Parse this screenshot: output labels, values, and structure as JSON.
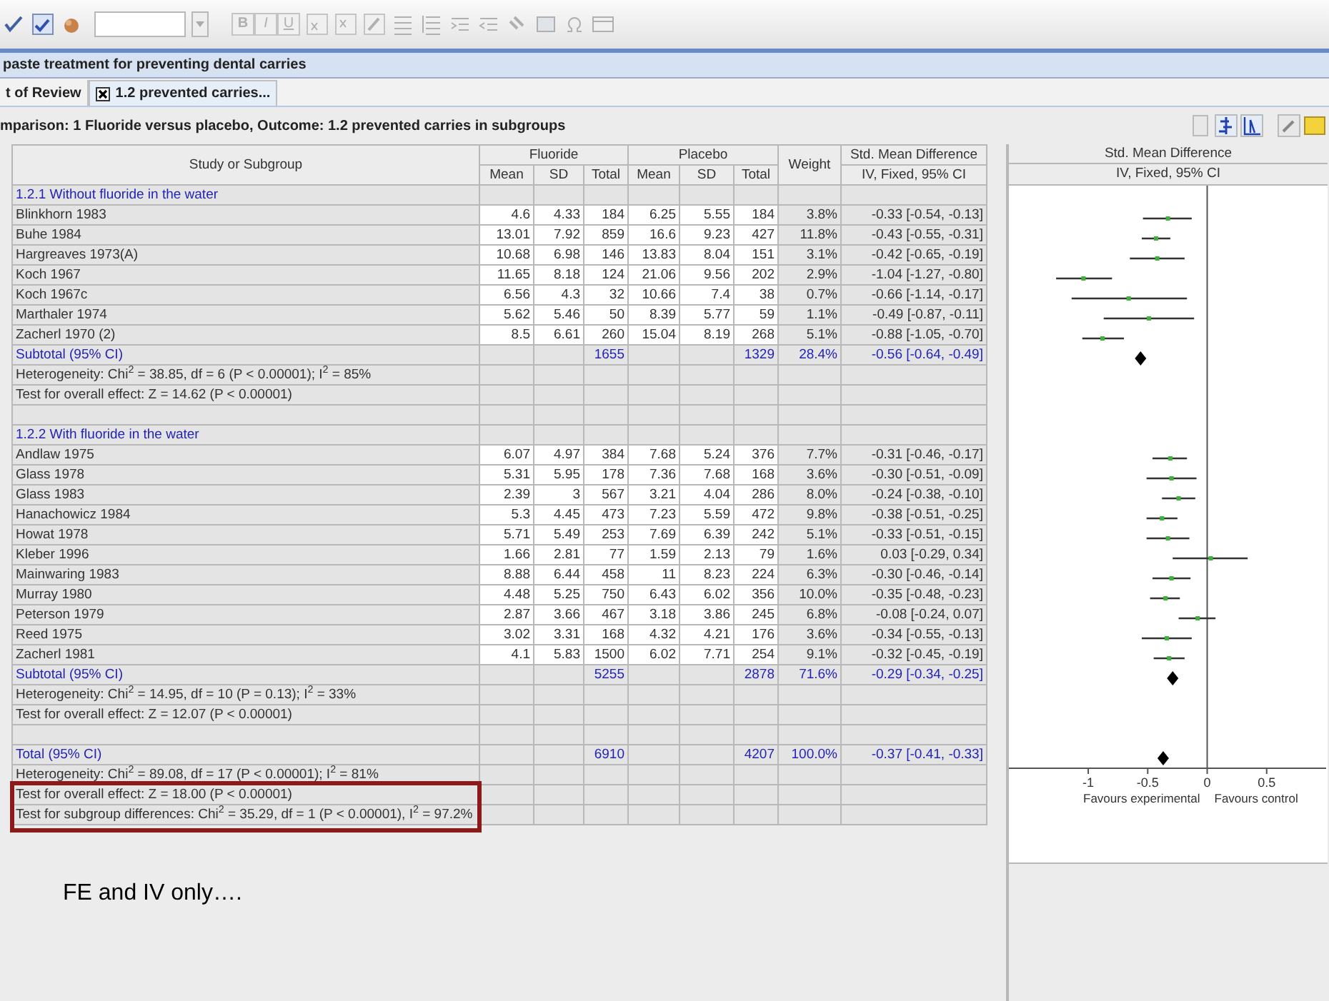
{
  "toolbar": {
    "format_buttons": [
      "B",
      "I",
      "U"
    ]
  },
  "review_title": "paste treatment for preventing dental carries",
  "tabs": [
    {
      "label": "t of Review",
      "selected": false,
      "closable": false
    },
    {
      "label": "1.2 prevented carries...",
      "selected": true,
      "closable": true
    }
  ],
  "comparison": "mparison: 1 Fluoride versus placebo, Outcome: 1.2 prevented carries in subgroups",
  "table": {
    "header": {
      "study": "Study or Subgroup",
      "fluoride": "Fluoride",
      "placebo": "Placebo",
      "f_mean": "Mean",
      "f_sd": "SD",
      "f_total": "Total",
      "p_mean": "Mean",
      "p_sd": "SD",
      "p_total": "Total",
      "weight": "Weight",
      "smd": "Std. Mean Difference",
      "method": "IV, Fixed, 95% CI"
    },
    "rows": [
      {
        "kind": "group",
        "study": "1.2.1 Without fluoride in the water"
      },
      {
        "kind": "study",
        "study": "Blinkhorn 1983",
        "f_mean": "4.6",
        "f_sd": "4.33",
        "f_total": "184",
        "p_mean": "6.25",
        "p_sd": "5.55",
        "p_total": "184",
        "weight": "3.8%",
        "smd": "-0.33 [-0.54, -0.13]"
      },
      {
        "kind": "study",
        "study": "Buhe 1984",
        "f_mean": "13.01",
        "f_sd": "7.92",
        "f_total": "859",
        "p_mean": "16.6",
        "p_sd": "9.23",
        "p_total": "427",
        "weight": "11.8%",
        "smd": "-0.43 [-0.55, -0.31]"
      },
      {
        "kind": "study",
        "study": "Hargreaves 1973(A)",
        "f_mean": "10.68",
        "f_sd": "6.98",
        "f_total": "146",
        "p_mean": "13.83",
        "p_sd": "8.04",
        "p_total": "151",
        "weight": "3.1%",
        "smd": "-0.42 [-0.65, -0.19]"
      },
      {
        "kind": "study",
        "study": "Koch 1967",
        "f_mean": "11.65",
        "f_sd": "8.18",
        "f_total": "124",
        "p_mean": "21.06",
        "p_sd": "9.56",
        "p_total": "202",
        "weight": "2.9%",
        "smd": "-1.04 [-1.27, -0.80]"
      },
      {
        "kind": "study",
        "study": "Koch 1967c",
        "f_mean": "6.56",
        "f_sd": "4.3",
        "f_total": "32",
        "p_mean": "10.66",
        "p_sd": "7.4",
        "p_total": "38",
        "weight": "0.7%",
        "smd": "-0.66 [-1.14, -0.17]"
      },
      {
        "kind": "study",
        "study": "Marthaler 1974",
        "f_mean": "5.62",
        "f_sd": "5.46",
        "f_total": "50",
        "p_mean": "8.39",
        "p_sd": "5.77",
        "p_total": "59",
        "weight": "1.1%",
        "smd": "-0.49 [-0.87, -0.11]"
      },
      {
        "kind": "study",
        "study": "Zacherl 1970 (2)",
        "f_mean": "8.5",
        "f_sd": "6.61",
        "f_total": "260",
        "p_mean": "15.04",
        "p_sd": "8.19",
        "p_total": "268",
        "weight": "5.1%",
        "smd": "-0.88 [-1.05, -0.70]"
      },
      {
        "kind": "subtotal",
        "study": "Subtotal (95% CI)",
        "f_total": "1655",
        "p_total": "1329",
        "weight": "28.4%",
        "smd": "-0.56 [-0.64, -0.49]"
      },
      {
        "kind": "note",
        "study": "Heterogeneity: Chi$^{2}$ = 38.85, df = 6 (P < 0.00001); I$^{2}$ = 85%"
      },
      {
        "kind": "note",
        "study": "Test for overall effect: Z = 14.62 (P < 0.00001)"
      },
      {
        "kind": "blank"
      },
      {
        "kind": "group",
        "study": "1.2.2 With fluoride in the water"
      },
      {
        "kind": "study",
        "study": "Andlaw 1975",
        "f_mean": "6.07",
        "f_sd": "4.97",
        "f_total": "384",
        "p_mean": "7.68",
        "p_sd": "5.24",
        "p_total": "376",
        "weight": "7.7%",
        "smd": "-0.31 [-0.46, -0.17]"
      },
      {
        "kind": "study",
        "study": "Glass 1978",
        "f_mean": "5.31",
        "f_sd": "5.95",
        "f_total": "178",
        "p_mean": "7.36",
        "p_sd": "7.68",
        "p_total": "168",
        "weight": "3.6%",
        "smd": "-0.30 [-0.51, -0.09]"
      },
      {
        "kind": "study",
        "study": "Glass 1983",
        "f_mean": "2.39",
        "f_sd": "3",
        "f_total": "567",
        "p_mean": "3.21",
        "p_sd": "4.04",
        "p_total": "286",
        "weight": "8.0%",
        "smd": "-0.24 [-0.38, -0.10]"
      },
      {
        "kind": "study",
        "study": "Hanachowicz 1984",
        "f_mean": "5.3",
        "f_sd": "4.45",
        "f_total": "473",
        "p_mean": "7.23",
        "p_sd": "5.59",
        "p_total": "472",
        "weight": "9.8%",
        "smd": "-0.38 [-0.51, -0.25]"
      },
      {
        "kind": "study",
        "study": "Howat 1978",
        "f_mean": "5.71",
        "f_sd": "5.49",
        "f_total": "253",
        "p_mean": "7.69",
        "p_sd": "6.39",
        "p_total": "242",
        "weight": "5.1%",
        "smd": "-0.33 [-0.51, -0.15]"
      },
      {
        "kind": "study",
        "study": "Kleber 1996",
        "f_mean": "1.66",
        "f_sd": "2.81",
        "f_total": "77",
        "p_mean": "1.59",
        "p_sd": "2.13",
        "p_total": "79",
        "weight": "1.6%",
        "smd": "0.03 [-0.29, 0.34]"
      },
      {
        "kind": "study",
        "study": "Mainwaring 1983",
        "f_mean": "8.88",
        "f_sd": "6.44",
        "f_total": "458",
        "p_mean": "11",
        "p_sd": "8.23",
        "p_total": "224",
        "weight": "6.3%",
        "smd": "-0.30 [-0.46, -0.14]"
      },
      {
        "kind": "study",
        "study": "Murray 1980",
        "f_mean": "4.48",
        "f_sd": "5.25",
        "f_total": "750",
        "p_mean": "6.43",
        "p_sd": "6.02",
        "p_total": "356",
        "weight": "10.0%",
        "smd": "-0.35 [-0.48, -0.23]"
      },
      {
        "kind": "study",
        "study": "Peterson 1979",
        "f_mean": "2.87",
        "f_sd": "3.66",
        "f_total": "467",
        "p_mean": "3.18",
        "p_sd": "3.86",
        "p_total": "245",
        "weight": "6.8%",
        "smd": "-0.08 [-0.24, 0.07]"
      },
      {
        "kind": "study",
        "study": "Reed 1975",
        "f_mean": "3.02",
        "f_sd": "3.31",
        "f_total": "168",
        "p_mean": "4.32",
        "p_sd": "4.21",
        "p_total": "176",
        "weight": "3.6%",
        "smd": "-0.34 [-0.55, -0.13]"
      },
      {
        "kind": "study",
        "study": "Zacherl 1981",
        "f_mean": "4.1",
        "f_sd": "5.83",
        "f_total": "1500",
        "p_mean": "6.02",
        "p_sd": "7.71",
        "p_total": "254",
        "weight": "9.1%",
        "smd": "-0.32 [-0.45, -0.19]"
      },
      {
        "kind": "subtotal",
        "study": "Subtotal (95% CI)",
        "f_total": "5255",
        "p_total": "2878",
        "weight": "71.6%",
        "smd": "-0.29 [-0.34, -0.25]"
      },
      {
        "kind": "note",
        "study": "Heterogeneity: Chi$^{2}$ = 14.95, df = 10 (P = 0.13); I$^{2}$ = 33%"
      },
      {
        "kind": "note",
        "study": "Test for overall effect: Z = 12.07 (P < 0.00001)"
      },
      {
        "kind": "blank"
      },
      {
        "kind": "total",
        "study": "Total (95% CI)",
        "f_total": "6910",
        "p_total": "4207",
        "weight": "100.0%",
        "smd": "-0.37 [-0.41, -0.33]"
      },
      {
        "kind": "note",
        "study": "Heterogeneity: Chi$^{2}$ = 89.08, df = 17 (P < 0.00001); I$^{2}$ = 81%"
      },
      {
        "kind": "note",
        "study": "Test for overall effect: Z = 18.00 (P < 0.00001)"
      },
      {
        "kind": "note",
        "study": "Test for subgroup differences: Chi$^{2}$ = 35.29, df = 1 (P < 0.00001), I$^{2}$ = 97.2%"
      }
    ]
  },
  "plot": {
    "title": "Std. Mean Difference",
    "subtitle": "IV, Fixed, 95% CI",
    "chart_data": {
      "type": "scatter",
      "orientation": "horizontal",
      "xlim": [
        -1.667,
        1
      ],
      "xticks": [
        -1,
        -0.5,
        0,
        0.5
      ],
      "series": [
        {
          "color": "#3cb43c",
          "values": [
            null,
            -0.33,
            -0.43,
            -0.42,
            -1.04,
            -0.66,
            -0.49,
            -0.88,
            null,
            null,
            null,
            null,
            null,
            -0.31,
            -0.3,
            -0.24,
            -0.38,
            -0.33,
            0.03,
            -0.3,
            -0.35,
            -0.08,
            -0.34,
            -0.32,
            null,
            null,
            null,
            null,
            null
          ],
          "errors": [
            null,
            [
              -0.54,
              -0.13
            ],
            [
              -0.55,
              -0.31
            ],
            [
              -0.65,
              -0.19
            ],
            [
              -1.27,
              -0.8
            ],
            [
              -1.14,
              -0.17
            ],
            [
              -0.87,
              -0.11
            ],
            [
              -1.05,
              -0.7
            ],
            null,
            null,
            null,
            null,
            null,
            [
              -0.46,
              -0.17
            ],
            [
              -0.51,
              -0.09
            ],
            [
              -0.38,
              -0.1
            ],
            [
              -0.51,
              -0.25
            ],
            [
              -0.51,
              -0.15
            ],
            [
              -0.29,
              0.34
            ],
            [
              -0.46,
              -0.14
            ],
            [
              -0.48,
              -0.23
            ],
            [
              -0.24,
              0.07
            ],
            [
              -0.55,
              -0.13
            ],
            [
              -0.45,
              -0.19
            ],
            null,
            null,
            null,
            null,
            null
          ]
        },
        {
          "color": "#000000",
          "values": [
            null,
            null,
            null,
            null,
            null,
            null,
            null,
            null,
            -0.56,
            null,
            null,
            null,
            null,
            null,
            null,
            null,
            null,
            null,
            null,
            null,
            null,
            null,
            null,
            null,
            -0.29,
            null,
            null,
            null,
            -0.37
          ]
        }
      ],
      "annotations": [
        {
          "text": "Favours experimental"
        },
        {
          "text": "Favours control"
        }
      ]
    }
  },
  "highlight_note": "FE and IV only…."
}
